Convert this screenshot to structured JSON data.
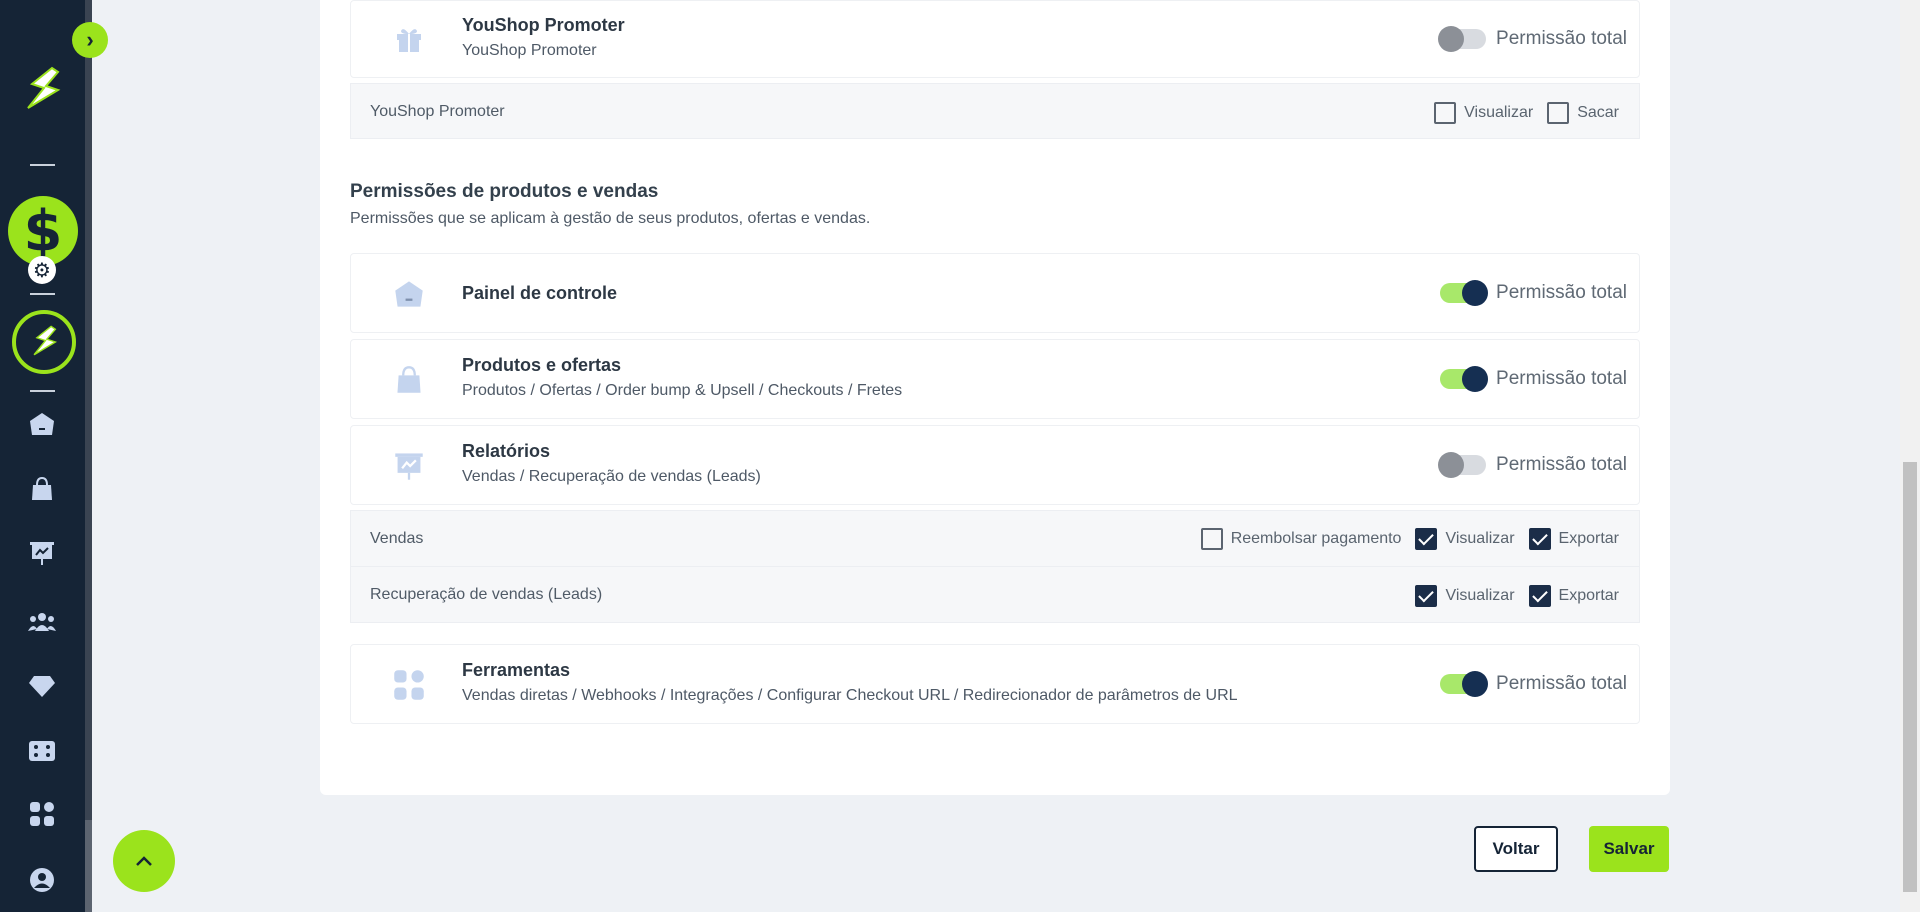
{
  "colors": {
    "accent": "#9be31c",
    "sidebar": "#152436",
    "toggle_on_knob": "#152f52"
  },
  "sidebar": {
    "collapse_icon": "chevron-right-icon",
    "items": [
      {
        "name": "home-icon"
      },
      {
        "name": "bag-icon"
      },
      {
        "name": "presentation-chart-icon"
      },
      {
        "name": "users-icon"
      },
      {
        "name": "diamond-icon"
      },
      {
        "name": "dice-icon"
      },
      {
        "name": "apps-grid-icon"
      },
      {
        "name": "user-circle-icon"
      }
    ]
  },
  "youshop": {
    "title": "YouShop Promoter",
    "subtitle": "YouShop Promoter",
    "toggle_label": "Permissão total",
    "toggle_on": false,
    "sub": {
      "label": "YouShop Promoter",
      "checks": [
        "Visualizar",
        "Sacar"
      ]
    }
  },
  "section": {
    "title": "Permissões de produtos e vendas",
    "description": "Permissões que se aplicam à gestão de seus produtos, ofertas e vendas."
  },
  "painel": {
    "title": "Painel de controle",
    "toggle_label": "Permissão total",
    "toggle_on": true
  },
  "produtos": {
    "title": "Produtos e ofertas",
    "subtitle": "Produtos / Ofertas / Order bump & Upsell / Checkouts / Fretes",
    "toggle_label": "Permissão total",
    "toggle_on": true
  },
  "relatorios": {
    "title": "Relatórios",
    "subtitle": "Vendas / Recuperação de vendas (Leads)",
    "toggle_label": "Permissão total",
    "toggle_on": false,
    "vendas": {
      "label": "Vendas",
      "refund": "Reembolsar pagamento",
      "view": "Visualizar",
      "export": "Exportar"
    },
    "leads": {
      "label": "Recuperação de vendas (Leads)",
      "view": "Visualizar",
      "export": "Exportar"
    }
  },
  "ferramentas": {
    "title": "Ferramentas",
    "subtitle": "Vendas diretas / Webhooks / Integrações / Configurar Checkout URL / Redirecionador de parâmetros de URL",
    "toggle_label": "Permissão total",
    "toggle_on": true
  },
  "actions": {
    "back": "Voltar",
    "save": "Salvar"
  }
}
